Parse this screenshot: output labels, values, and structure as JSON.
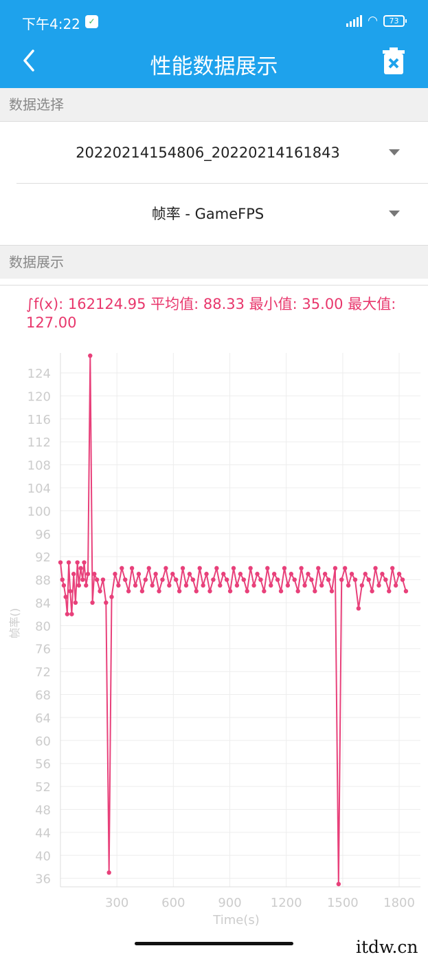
{
  "status_bar": {
    "time": "下午4:22",
    "shield_icon": "shield-check-icon",
    "battery": "73"
  },
  "app_bar": {
    "title": "性能数据展示",
    "back_icon": "chevron-left-icon",
    "delete_icon": "trash-x-icon"
  },
  "data_select": {
    "header": "数据选择",
    "file": "20220214154806_20220214161843",
    "metric": "帧率 - GameFPS"
  },
  "data_display": {
    "header": "数据展示",
    "stats": "∫f(x): 162124.95 平均值: 88.33 最小值: 35.00 最大值: 127.00"
  },
  "chart_data": {
    "type": "line",
    "xlabel": "Time(s)",
    "ylabel": "帧率()",
    "x_ticks": [
      300,
      600,
      900,
      1200,
      1500,
      1800
    ],
    "y_ticks": [
      36,
      40,
      44,
      48,
      52,
      56,
      60,
      64,
      68,
      72,
      76,
      80,
      84,
      88,
      92,
      96,
      100,
      104,
      108,
      112,
      116,
      120,
      124
    ],
    "xlim": [
      0,
      1840
    ],
    "ylim": [
      35,
      127
    ],
    "series": [
      {
        "name": "",
        "color": "#e8407a"
      }
    ],
    "grid": true,
    "points": [
      {
        "x": 0,
        "y": 91
      },
      {
        "x": 10,
        "y": 88
      },
      {
        "x": 18,
        "y": 87
      },
      {
        "x": 28,
        "y": 85
      },
      {
        "x": 36,
        "y": 82
      },
      {
        "x": 44,
        "y": 91
      },
      {
        "x": 52,
        "y": 86
      },
      {
        "x": 60,
        "y": 82
      },
      {
        "x": 70,
        "y": 89
      },
      {
        "x": 80,
        "y": 84
      },
      {
        "x": 90,
        "y": 91
      },
      {
        "x": 98,
        "y": 87
      },
      {
        "x": 108,
        "y": 90
      },
      {
        "x": 118,
        "y": 88
      },
      {
        "x": 126,
        "y": 91
      },
      {
        "x": 136,
        "y": 87
      },
      {
        "x": 146,
        "y": 89
      },
      {
        "x": 158,
        "y": 127
      },
      {
        "x": 170,
        "y": 84
      },
      {
        "x": 180,
        "y": 89
      },
      {
        "x": 194,
        "y": 88
      },
      {
        "x": 210,
        "y": 86
      },
      {
        "x": 226,
        "y": 88
      },
      {
        "x": 242,
        "y": 84
      },
      {
        "x": 258,
        "y": 37
      },
      {
        "x": 272,
        "y": 85
      },
      {
        "x": 290,
        "y": 89
      },
      {
        "x": 308,
        "y": 87
      },
      {
        "x": 326,
        "y": 90
      },
      {
        "x": 344,
        "y": 88
      },
      {
        "x": 362,
        "y": 86
      },
      {
        "x": 380,
        "y": 90
      },
      {
        "x": 398,
        "y": 87
      },
      {
        "x": 416,
        "y": 89
      },
      {
        "x": 434,
        "y": 86
      },
      {
        "x": 452,
        "y": 88
      },
      {
        "x": 470,
        "y": 90
      },
      {
        "x": 488,
        "y": 87
      },
      {
        "x": 506,
        "y": 89
      },
      {
        "x": 524,
        "y": 86
      },
      {
        "x": 542,
        "y": 88
      },
      {
        "x": 560,
        "y": 90
      },
      {
        "x": 578,
        "y": 87
      },
      {
        "x": 596,
        "y": 89
      },
      {
        "x": 614,
        "y": 88
      },
      {
        "x": 632,
        "y": 86
      },
      {
        "x": 650,
        "y": 90
      },
      {
        "x": 668,
        "y": 87
      },
      {
        "x": 686,
        "y": 89
      },
      {
        "x": 704,
        "y": 88
      },
      {
        "x": 722,
        "y": 86
      },
      {
        "x": 740,
        "y": 90
      },
      {
        "x": 758,
        "y": 87
      },
      {
        "x": 776,
        "y": 89
      },
      {
        "x": 794,
        "y": 86
      },
      {
        "x": 812,
        "y": 88
      },
      {
        "x": 830,
        "y": 90
      },
      {
        "x": 848,
        "y": 87
      },
      {
        "x": 866,
        "y": 89
      },
      {
        "x": 884,
        "y": 88
      },
      {
        "x": 902,
        "y": 86
      },
      {
        "x": 920,
        "y": 90
      },
      {
        "x": 938,
        "y": 87
      },
      {
        "x": 956,
        "y": 89
      },
      {
        "x": 974,
        "y": 88
      },
      {
        "x": 992,
        "y": 86
      },
      {
        "x": 1010,
        "y": 90
      },
      {
        "x": 1028,
        "y": 87
      },
      {
        "x": 1046,
        "y": 89
      },
      {
        "x": 1064,
        "y": 88
      },
      {
        "x": 1082,
        "y": 86
      },
      {
        "x": 1100,
        "y": 90
      },
      {
        "x": 1118,
        "y": 87
      },
      {
        "x": 1136,
        "y": 89
      },
      {
        "x": 1154,
        "y": 88
      },
      {
        "x": 1172,
        "y": 86
      },
      {
        "x": 1190,
        "y": 90
      },
      {
        "x": 1208,
        "y": 87
      },
      {
        "x": 1226,
        "y": 89
      },
      {
        "x": 1244,
        "y": 88
      },
      {
        "x": 1262,
        "y": 86
      },
      {
        "x": 1280,
        "y": 90
      },
      {
        "x": 1298,
        "y": 87
      },
      {
        "x": 1316,
        "y": 89
      },
      {
        "x": 1334,
        "y": 88
      },
      {
        "x": 1352,
        "y": 86
      },
      {
        "x": 1370,
        "y": 90
      },
      {
        "x": 1388,
        "y": 87
      },
      {
        "x": 1406,
        "y": 89
      },
      {
        "x": 1424,
        "y": 88
      },
      {
        "x": 1442,
        "y": 86
      },
      {
        "x": 1460,
        "y": 90
      },
      {
        "x": 1478,
        "y": 35
      },
      {
        "x": 1494,
        "y": 88
      },
      {
        "x": 1512,
        "y": 90
      },
      {
        "x": 1530,
        "y": 87
      },
      {
        "x": 1548,
        "y": 89
      },
      {
        "x": 1566,
        "y": 88
      },
      {
        "x": 1584,
        "y": 83
      },
      {
        "x": 1602,
        "y": 87
      },
      {
        "x": 1620,
        "y": 89
      },
      {
        "x": 1638,
        "y": 88
      },
      {
        "x": 1656,
        "y": 86
      },
      {
        "x": 1674,
        "y": 90
      },
      {
        "x": 1692,
        "y": 87
      },
      {
        "x": 1710,
        "y": 89
      },
      {
        "x": 1728,
        "y": 88
      },
      {
        "x": 1746,
        "y": 86
      },
      {
        "x": 1764,
        "y": 90
      },
      {
        "x": 1782,
        "y": 87
      },
      {
        "x": 1800,
        "y": 89
      },
      {
        "x": 1818,
        "y": 88
      },
      {
        "x": 1836,
        "y": 86
      }
    ]
  }
}
